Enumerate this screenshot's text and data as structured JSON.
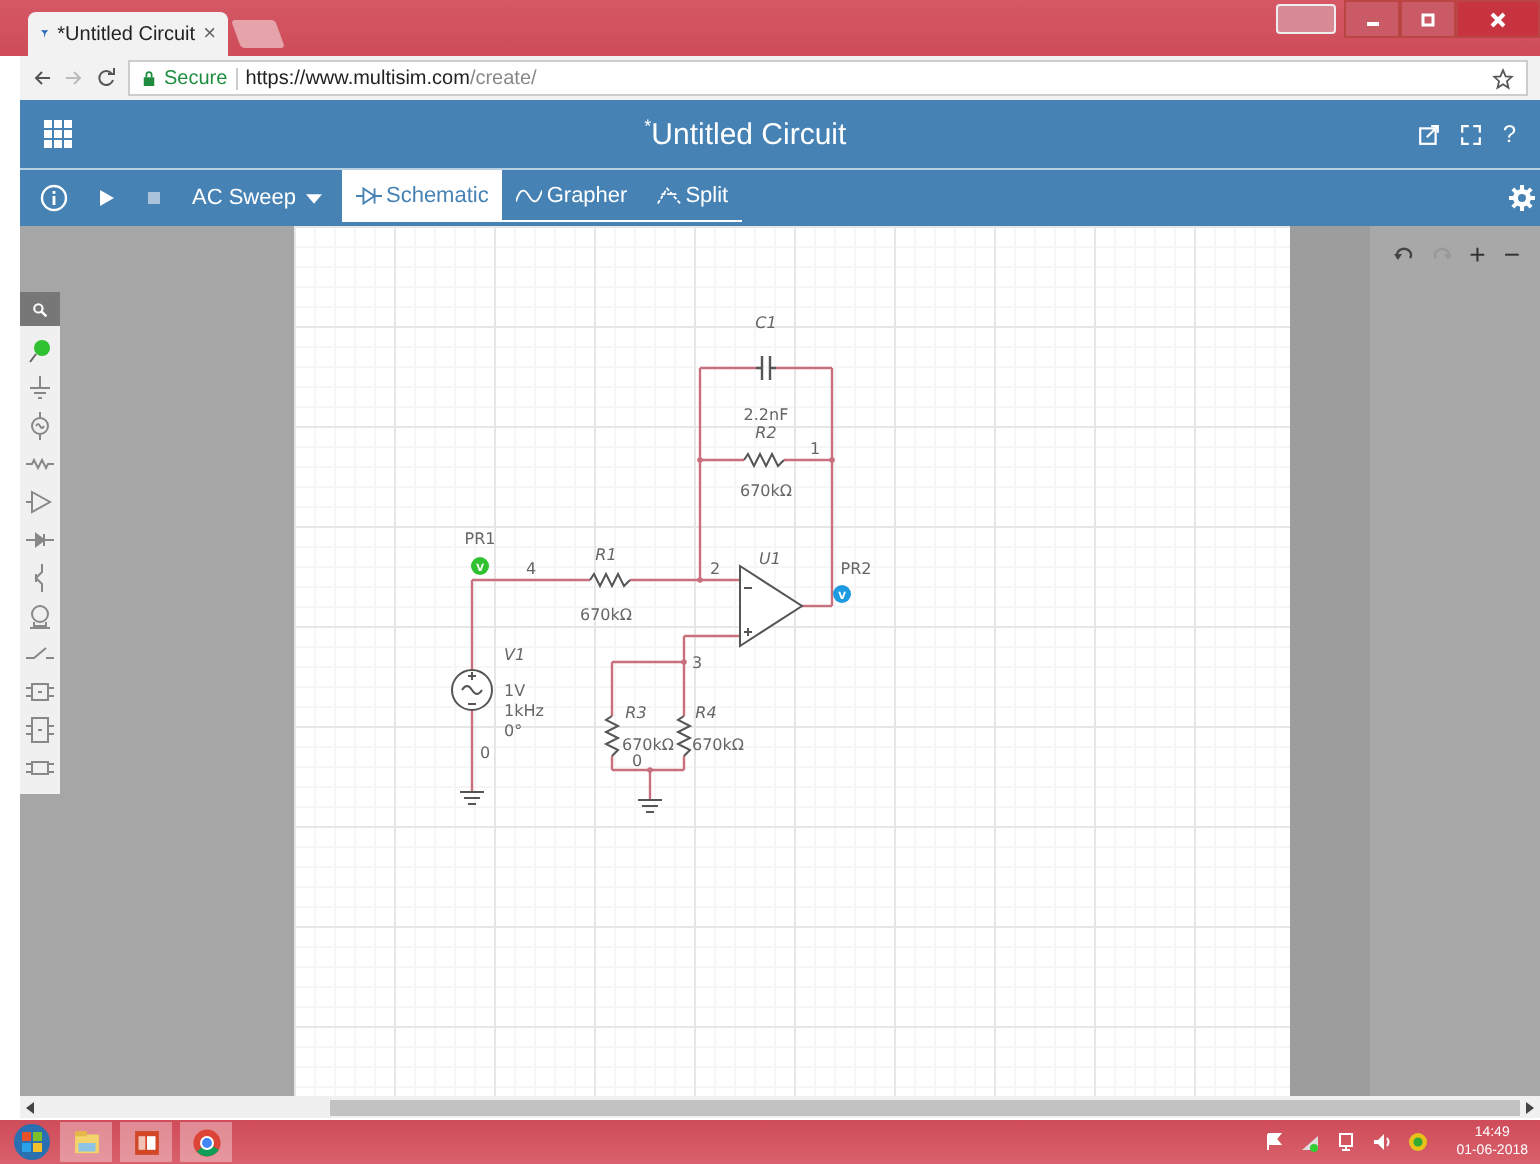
{
  "browser": {
    "tab_title": "*Untitled Circuit",
    "tab_close": "×",
    "secure": "Secure",
    "url_host": "https://www.multisim.com",
    "url_path": "/create/"
  },
  "header": {
    "title_mark": "*",
    "title": "Untitled Circuit",
    "help": "?"
  },
  "toolbar": {
    "analysis": "AC Sweep",
    "tabs": [
      {
        "label": "Schematic",
        "selected": true
      },
      {
        "label": "Grapher",
        "selected": false
      },
      {
        "label": "Split",
        "selected": false
      }
    ]
  },
  "canvas_controls": {
    "zoom_in": "+",
    "zoom_out": "−"
  },
  "circuit": {
    "components": [
      {
        "ref": "C1",
        "values": [
          "2.2nF"
        ]
      },
      {
        "ref": "R2",
        "values": [
          "670kΩ"
        ]
      },
      {
        "ref": "R1",
        "values": [
          "670kΩ"
        ]
      },
      {
        "ref": "U1"
      },
      {
        "ref": "V1",
        "values": [
          "1V",
          "1kHz",
          "0°"
        ]
      },
      {
        "ref": "R3",
        "values": [
          "670kΩ"
        ]
      },
      {
        "ref": "R4",
        "values": [
          "670kΩ"
        ]
      }
    ],
    "nets": [
      "1",
      "2",
      "3",
      "4",
      "0",
      "0"
    ],
    "probes": [
      {
        "label": "PR1",
        "symbol": "V",
        "color": "#2fc12f"
      },
      {
        "label": "PR2",
        "symbol": "V",
        "color": "#1e9be0"
      }
    ]
  },
  "taskbar": {
    "time": "14:49",
    "date": "01-06-2018"
  }
}
